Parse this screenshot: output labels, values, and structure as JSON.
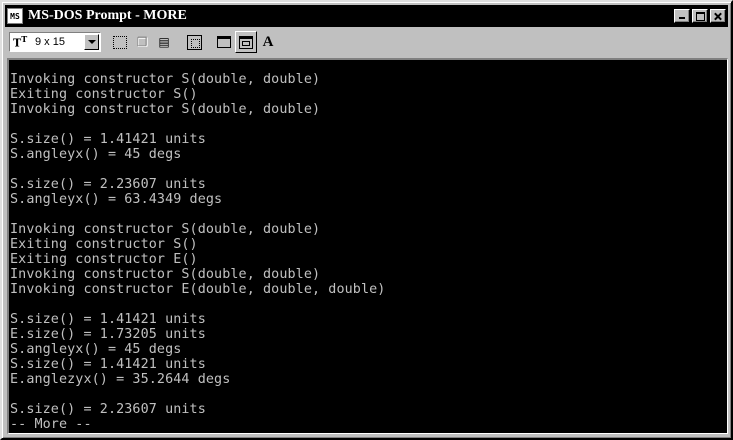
{
  "window": {
    "title": "MS-DOS Prompt - MORE",
    "icon": "msdos-icon",
    "caption_buttons": [
      "minimize-icon",
      "maximize-icon",
      "close-icon"
    ]
  },
  "toolbar": {
    "font_icon_label": "T",
    "font_size_value": "9 x 15",
    "font_button_label": "A",
    "buttons": [
      "mark-icon",
      "copy-icon",
      "paste-icon",
      "fullscreen-icon",
      "properties-icon",
      "background-icon",
      "font-icon"
    ]
  },
  "console": {
    "text_color": "#c0c0c0",
    "background_color": "#000000",
    "lines": [
      "Invoking constructor S(double, double)",
      "Exiting constructor S()",
      "Invoking constructor S(double, double)",
      "",
      "S.size() = 1.41421 units",
      "S.angleyx() = 45 degs",
      "",
      "S.size() = 2.23607 units",
      "S.angleyx() = 63.4349 degs",
      "",
      "Invoking constructor S(double, double)",
      "Exiting constructor S()",
      "Exiting constructor E()",
      "Invoking constructor S(double, double)",
      "Invoking constructor E(double, double, double)",
      "",
      "S.size() = 1.41421 units",
      "E.size() = 1.73205 units",
      "S.angleyx() = 45 degs",
      "S.size() = 1.41421 units",
      "E.anglezyx() = 35.2644 degs",
      "",
      "S.size() = 2.23607 units",
      "-- More --"
    ]
  }
}
